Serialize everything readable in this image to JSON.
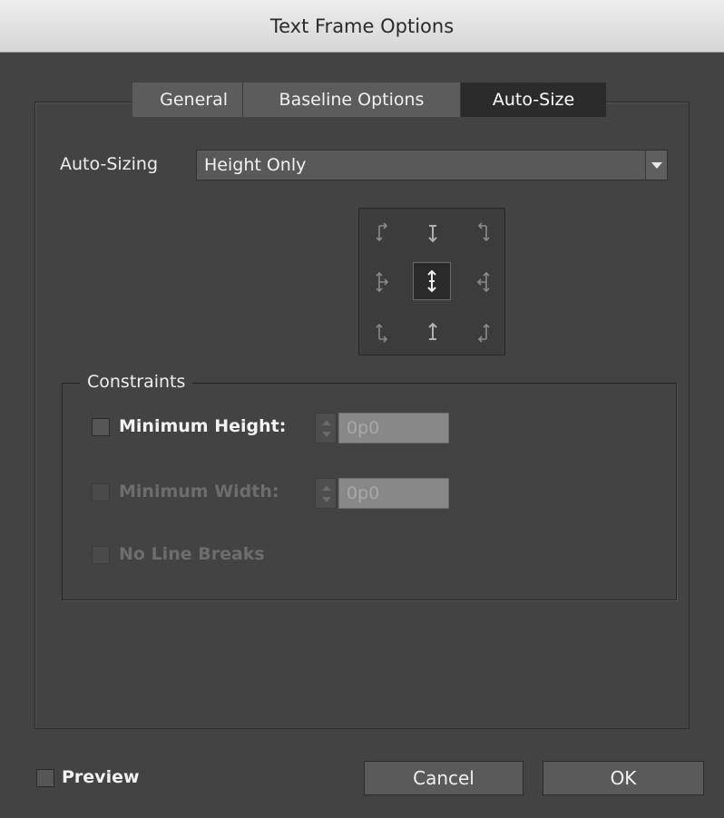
{
  "window": {
    "title": "Text Frame Options"
  },
  "tabs": [
    {
      "label": "General",
      "active": false
    },
    {
      "label": "Baseline Options",
      "active": false
    },
    {
      "label": "Auto-Size",
      "active": true
    }
  ],
  "auto_sizing": {
    "label": "Auto-Sizing",
    "value": "Height Only"
  },
  "reference_point": {
    "selected": "center",
    "cells": [
      "top-left-arrow-icon",
      "top-center-arrow-icon",
      "top-right-arrow-icon",
      "middle-left-arrow-icon",
      "center-vertical-arrow-icon",
      "middle-right-arrow-icon",
      "bottom-left-arrow-icon",
      "bottom-center-arrow-icon",
      "bottom-right-arrow-icon"
    ]
  },
  "constraints": {
    "title": "Constraints",
    "min_height": {
      "label": "Minimum Height:",
      "value": "0p0",
      "checked": false,
      "enabled": true
    },
    "min_width": {
      "label": "Minimum Width:",
      "value": "0p0",
      "checked": false,
      "enabled": false
    },
    "no_line_breaks": {
      "label": "No Line Breaks",
      "checked": false,
      "enabled": false
    }
  },
  "footer": {
    "preview_label": "Preview",
    "cancel_label": "Cancel",
    "ok_label": "OK"
  },
  "colors": {
    "dialog_bg": "#434343",
    "active_tab": "#2b2b2b",
    "tab_bg": "#5c5c5c"
  }
}
